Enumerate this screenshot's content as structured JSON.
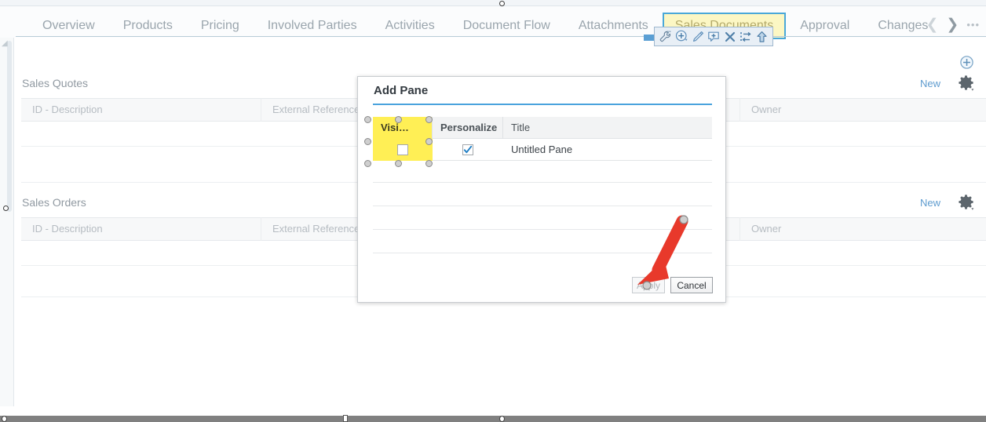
{
  "tabbar": {
    "tabs": [
      {
        "label": "Overview",
        "selected": false
      },
      {
        "label": "Products",
        "selected": false
      },
      {
        "label": "Pricing",
        "selected": false
      },
      {
        "label": "Involved Parties",
        "selected": false
      },
      {
        "label": "Activities",
        "selected": false
      },
      {
        "label": "Document Flow",
        "selected": false
      },
      {
        "label": "Attachments",
        "selected": false
      },
      {
        "label": "Sales Documents",
        "selected": true
      },
      {
        "label": "Approval",
        "selected": false
      },
      {
        "label": "Changes",
        "selected": false
      }
    ],
    "nav": {
      "prev_icon": "chevron-left-icon",
      "next_icon": "chevron-right-icon",
      "more_icon": "ellipsis-icon",
      "more_label": "•••"
    },
    "selected_tab_bg": "#fcf7c4",
    "selected_tab_border": "#4aa8d8"
  },
  "minitoolbar": {
    "icons": [
      {
        "name": "wrench-icon",
        "title": "Configure"
      },
      {
        "name": "add-circle-icon",
        "title": "Add"
      },
      {
        "name": "pencil-icon",
        "title": "Edit"
      },
      {
        "name": "add-note-icon",
        "title": "Add Note"
      },
      {
        "name": "delete-x-icon",
        "title": "Delete"
      },
      {
        "name": "rearrange-icon",
        "title": "Rearrange"
      },
      {
        "name": "move-up-icon",
        "title": "Move Up"
      }
    ]
  },
  "sections": [
    {
      "title": "Sales Quotes",
      "new_label": "New",
      "gear_icon": "gear-icon",
      "plus_icon": "add-circle-icon",
      "columns": [
        "ID - Description",
        "External Reference",
        "Owner"
      ]
    },
    {
      "title": "Sales Orders",
      "new_label": "New",
      "gear_icon": "gear-icon",
      "columns": [
        "ID - Description",
        "External Reference",
        "Owner"
      ]
    }
  ],
  "dialog": {
    "title": "Add Pane",
    "columns": [
      {
        "label": "Visi…",
        "highlighted": true
      },
      {
        "label": "Personalize",
        "highlighted": false
      },
      {
        "label": "Title",
        "highlighted": false
      }
    ],
    "rows": [
      {
        "visible_checked": false,
        "personalize_checked": true,
        "title": "Untitled Pane"
      }
    ],
    "buttons": [
      {
        "label": "Apply",
        "enabled": false
      },
      {
        "label": "Cancel",
        "enabled": true
      }
    ],
    "accent_color": "#4aa3dd",
    "highlight_color": "#ffef55"
  },
  "annotation": {
    "arrow_color": "#e8392b",
    "points_to": "Apply"
  }
}
